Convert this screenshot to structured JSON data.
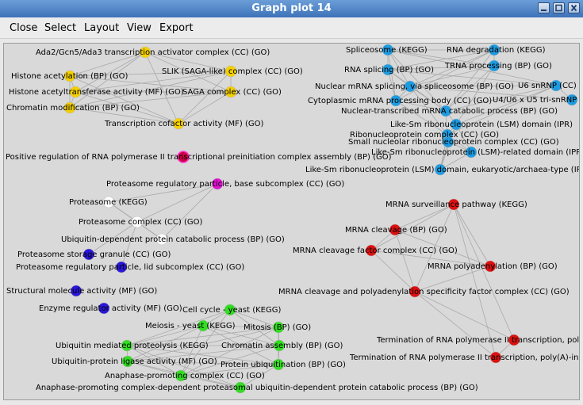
{
  "window": {
    "title": "Graph plot 14"
  },
  "menu": {
    "close": "Close",
    "select": "Select",
    "layout": "Layout",
    "view": "View",
    "export": "Export"
  },
  "colors": {
    "yellow": "#f5d000",
    "blue": "#1e9be0",
    "magenta": "#e010d0",
    "white": "#ffffff",
    "navy": "#2a16d8",
    "red": "#dd1010",
    "green": "#33dd22",
    "crimson": "#cc0044"
  },
  "graph": {
    "nodes": [
      {
        "id": "y1",
        "label": "Ada2/Gcn5/Ada3 transcription activator complex (CC) (GO)",
        "color": "yellow"
      },
      {
        "id": "y2",
        "label": "Histone acetylation (BP) (GO)",
        "color": "yellow"
      },
      {
        "id": "y3",
        "label": "SLIK (SAGA-like) complex (CC) (GO)",
        "color": "yellow"
      },
      {
        "id": "y4",
        "label": "Histone acetyltransferase activity (MF) (GO)",
        "color": "yellow"
      },
      {
        "id": "y5",
        "label": "SAGA complex (CC) (GO)",
        "color": "yellow"
      },
      {
        "id": "y6",
        "label": "Chromatin modification (BP) (GO)",
        "color": "yellow"
      },
      {
        "id": "y7",
        "label": "Transcription cofactor activity (MF) (GO)",
        "color": "yellow"
      },
      {
        "id": "c1",
        "label": "Positive regulation of RNA polymerase II transcriptional preinitiation complex assembly (BP) (GO)",
        "color": "crimson"
      },
      {
        "id": "b1",
        "label": "Spliceosome (KEGG)",
        "color": "blue"
      },
      {
        "id": "b2",
        "label": "RNA degradation (KEGG)",
        "color": "blue"
      },
      {
        "id": "b3",
        "label": "RNA splicing (BP) (GO)",
        "color": "blue"
      },
      {
        "id": "b4",
        "label": "TRNA processing (BP) (GO)",
        "color": "blue"
      },
      {
        "id": "b5",
        "label": "Nuclear mRNA splicing, via spliceosome (BP) (GO)",
        "color": "blue"
      },
      {
        "id": "b6",
        "label": "U6 snRNP (CC)",
        "color": "blue"
      },
      {
        "id": "b7",
        "label": "U4/U6 x U5 tri-snRNP",
        "color": "blue"
      },
      {
        "id": "b8",
        "label": "Cytoplasmic mRNA processing body (CC) (GO)",
        "color": "blue"
      },
      {
        "id": "b9",
        "label": "Nuclear-transcribed mRNA catabolic process (BP) (GO)",
        "color": "blue"
      },
      {
        "id": "b10",
        "label": "Like-Sm ribonucleoprotein (LSM) domain (IPR)",
        "color": "blue"
      },
      {
        "id": "b11",
        "label": "Ribonucleoprotein complex (CC) (GO)",
        "color": "blue"
      },
      {
        "id": "b12",
        "label": "Small nucleolar ribonucleoprotein complex (CC) (GO)",
        "color": "blue"
      },
      {
        "id": "b13",
        "label": "Like-Sm ribonucleoprotein (LSM)-related domain (IPR)",
        "color": "blue"
      },
      {
        "id": "b14",
        "label": "Like-Sm ribonucleoprotein (LSM) domain, eukaryotic/archaea-type (IPR)",
        "color": "blue"
      },
      {
        "id": "m1",
        "label": "Proteasome regulatory particle, base subcomplex (CC) (GO)",
        "color": "magenta"
      },
      {
        "id": "w1",
        "label": "Proteasome (KEGG)",
        "color": "white"
      },
      {
        "id": "w2",
        "label": "Proteasome complex (CC) (GO)",
        "color": "white"
      },
      {
        "id": "w3",
        "label": "Ubiquitin-dependent protein catabolic process (BP) (GO)",
        "color": "white"
      },
      {
        "id": "n1",
        "label": "Proteasome storage granule (CC) (GO)",
        "color": "navy"
      },
      {
        "id": "n2",
        "label": "Proteasome regulatory particle, lid subcomplex (CC) (GO)",
        "color": "navy"
      },
      {
        "id": "n3",
        "label": "Structural molecule activity (MF) (GO)",
        "color": "navy"
      },
      {
        "id": "n4",
        "label": "Enzyme regulator activity (MF) (GO)",
        "color": "navy"
      },
      {
        "id": "r1",
        "label": "MRNA surveillance pathway (KEGG)",
        "color": "red"
      },
      {
        "id": "r2",
        "label": "MRNA cleavage (BP) (GO)",
        "color": "red"
      },
      {
        "id": "r3",
        "label": "MRNA cleavage factor complex (CC) (GO)",
        "color": "red"
      },
      {
        "id": "r4",
        "label": "MRNA polyadenylation (BP) (GO)",
        "color": "red"
      },
      {
        "id": "r5",
        "label": "MRNA cleavage and polyadenylation specificity factor complex (CC) (GO)",
        "color": "red"
      },
      {
        "id": "r6",
        "label": "Termination of RNA polymerase II transcription, poly(A",
        "color": "red"
      },
      {
        "id": "r7",
        "label": "Termination of RNA polymerase II transcription, poly(A)-indepe",
        "color": "red"
      },
      {
        "id": "g1",
        "label": "Cell cycle - yeast (KEGG)",
        "color": "green"
      },
      {
        "id": "g2",
        "label": "Meiosis - yeast (KEGG)",
        "color": "green"
      },
      {
        "id": "g3",
        "label": "Mitosis (BP) (GO)",
        "color": "green"
      },
      {
        "id": "g4",
        "label": "Ubiquitin mediated proteolysis (KEGG)",
        "color": "green"
      },
      {
        "id": "g5",
        "label": "Chromatin assembly (BP) (GO)",
        "color": "green"
      },
      {
        "id": "g6",
        "label": "Ubiquitin-protein ligase activity (MF) (GO)",
        "color": "green"
      },
      {
        "id": "g7",
        "label": "Protein ubiquitination (BP) (GO)",
        "color": "green"
      },
      {
        "id": "g8",
        "label": "Anaphase-promoting complex (CC) (GO)",
        "color": "green"
      },
      {
        "id": "g9",
        "label": "Anaphase-promoting complex-dependent proteasomal ubiquitin-dependent protein catabolic process (BP) (GO)",
        "color": "green"
      }
    ],
    "edges": [
      [
        "y1",
        "y2"
      ],
      [
        "y1",
        "y3"
      ],
      [
        "y1",
        "y4"
      ],
      [
        "y1",
        "y5"
      ],
      [
        "y1",
        "y6"
      ],
      [
        "y1",
        "y7"
      ],
      [
        "y2",
        "y3"
      ],
      [
        "y2",
        "y4"
      ],
      [
        "y2",
        "y5"
      ],
      [
        "y2",
        "y6"
      ],
      [
        "y2",
        "y7"
      ],
      [
        "y3",
        "y4"
      ],
      [
        "y3",
        "y5"
      ],
      [
        "y3",
        "y6"
      ],
      [
        "y3",
        "y7"
      ],
      [
        "y4",
        "y5"
      ],
      [
        "y4",
        "y6"
      ],
      [
        "y4",
        "y7"
      ],
      [
        "y5",
        "y6"
      ],
      [
        "y5",
        "y7"
      ],
      [
        "y6",
        "y7"
      ],
      [
        "b1",
        "b2"
      ],
      [
        "b1",
        "b3"
      ],
      [
        "b1",
        "b4"
      ],
      [
        "b1",
        "b5"
      ],
      [
        "b1",
        "b6"
      ],
      [
        "b1",
        "b8"
      ],
      [
        "b1",
        "b9"
      ],
      [
        "b2",
        "b4"
      ],
      [
        "b2",
        "b8"
      ],
      [
        "b2",
        "b9"
      ],
      [
        "b2",
        "b3"
      ],
      [
        "b2",
        "b5"
      ],
      [
        "b3",
        "b5"
      ],
      [
        "b3",
        "b4"
      ],
      [
        "b3",
        "b8"
      ],
      [
        "b3",
        "b9"
      ],
      [
        "b3",
        "b6"
      ],
      [
        "b4",
        "b9"
      ],
      [
        "b4",
        "b5"
      ],
      [
        "b4",
        "b10"
      ],
      [
        "b5",
        "b6"
      ],
      [
        "b5",
        "b7"
      ],
      [
        "b5",
        "b8"
      ],
      [
        "b5",
        "b9"
      ],
      [
        "b5",
        "b11"
      ],
      [
        "b6",
        "b7"
      ],
      [
        "b6",
        "b9"
      ],
      [
        "b6",
        "b10"
      ],
      [
        "b6",
        "b11"
      ],
      [
        "b8",
        "b9"
      ],
      [
        "b8",
        "b11"
      ],
      [
        "b9",
        "b10"
      ],
      [
        "b9",
        "b11"
      ],
      [
        "b10",
        "b11"
      ],
      [
        "b10",
        "b12"
      ],
      [
        "b10",
        "b13"
      ],
      [
        "b10",
        "b14"
      ],
      [
        "b11",
        "b12"
      ],
      [
        "b11",
        "b13"
      ],
      [
        "b11",
        "b14"
      ],
      [
        "b12",
        "b13"
      ],
      [
        "b12",
        "b14"
      ],
      [
        "b13",
        "b14"
      ],
      [
        "m1",
        "w1"
      ],
      [
        "m1",
        "w2"
      ],
      [
        "m1",
        "w3"
      ],
      [
        "w1",
        "w2"
      ],
      [
        "w1",
        "w3"
      ],
      [
        "w2",
        "w3"
      ],
      [
        "w2",
        "n1"
      ],
      [
        "w2",
        "n2"
      ],
      [
        "r1",
        "r2"
      ],
      [
        "r1",
        "r3"
      ],
      [
        "r1",
        "r4"
      ],
      [
        "r1",
        "r5"
      ],
      [
        "r1",
        "r7"
      ],
      [
        "r2",
        "r3"
      ],
      [
        "r2",
        "r4"
      ],
      [
        "r2",
        "r5"
      ],
      [
        "r3",
        "r4"
      ],
      [
        "r3",
        "r5"
      ],
      [
        "r4",
        "r5"
      ],
      [
        "r5",
        "r6"
      ],
      [
        "r5",
        "r7"
      ],
      [
        "r6",
        "r7"
      ],
      [
        "r1",
        "r6"
      ],
      [
        "g1",
        "g2"
      ],
      [
        "g1",
        "g3"
      ],
      [
        "g1",
        "g4"
      ],
      [
        "g1",
        "g5"
      ],
      [
        "g1",
        "g8"
      ],
      [
        "g2",
        "g3"
      ],
      [
        "g2",
        "g4"
      ],
      [
        "g2",
        "g5"
      ],
      [
        "g2",
        "g6"
      ],
      [
        "g2",
        "g7"
      ],
      [
        "g2",
        "g8"
      ],
      [
        "g3",
        "g4"
      ],
      [
        "g3",
        "g5"
      ],
      [
        "g3",
        "g6"
      ],
      [
        "g3",
        "g7"
      ],
      [
        "g3",
        "g8"
      ],
      [
        "g4",
        "g5"
      ],
      [
        "g4",
        "g6"
      ],
      [
        "g4",
        "g7"
      ],
      [
        "g4",
        "g8"
      ],
      [
        "g4",
        "g9"
      ],
      [
        "g5",
        "g6"
      ],
      [
        "g5",
        "g7"
      ],
      [
        "g5",
        "g8"
      ],
      [
        "g6",
        "g7"
      ],
      [
        "g6",
        "g8"
      ],
      [
        "g6",
        "g9"
      ],
      [
        "g7",
        "g8"
      ],
      [
        "g7",
        "g9"
      ],
      [
        "g8",
        "g9"
      ]
    ]
  }
}
